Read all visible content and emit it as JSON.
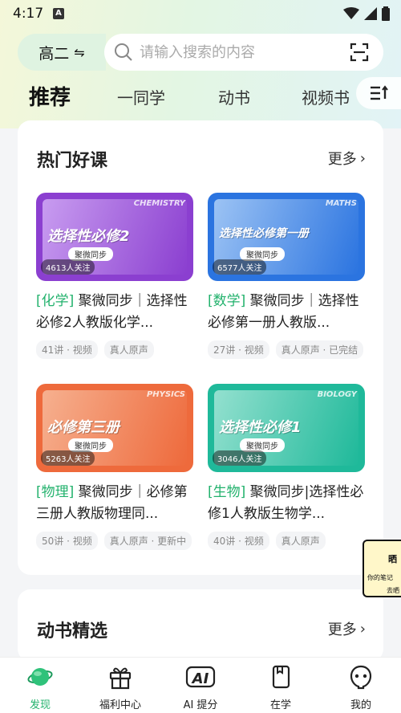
{
  "status": {
    "time": "4:17"
  },
  "header": {
    "grade": "高二",
    "grade_swap_icon": "swap-icon",
    "search_placeholder": "请输入搜索的内容"
  },
  "tabs": [
    {
      "label": "推荐",
      "active": true
    },
    {
      "label": "一同学"
    },
    {
      "label": "动书"
    },
    {
      "label": "视频书"
    }
  ],
  "hot_courses": {
    "title": "热门好课",
    "more": "更多",
    "items": [
      {
        "tag": "[化学]",
        "title": " 聚微同步｜选择性必修2人教版化学...",
        "followers": "4613人关注",
        "cover_title": "选择性必修2",
        "cover_sub": "聚微同步",
        "cover_en": "CHEMISTRY",
        "chips": [
          "41讲 · 视频",
          "真人原声"
        ],
        "color_a": "#8b3fd0",
        "color_b": "#c89cf0"
      },
      {
        "tag": "[数学]",
        "title": " 聚微同步｜选择性必修第一册人教版...",
        "followers": "6577人关注",
        "cover_title": "选择性必修第一册",
        "cover_sub": "聚微同步",
        "cover_en": "MATHS",
        "chips": [
          "27讲 · 视频",
          "真人原声 · 已完结"
        ],
        "color_a": "#2b74e0",
        "color_b": "#9cc3f4"
      },
      {
        "tag": "[物理]",
        "title": " 聚微同步｜必修第三册人教版物理同...",
        "followers": "5263人关注",
        "cover_title": "必修第三册",
        "cover_sub": "聚微同步",
        "cover_en": "PHYSICS",
        "chips": [
          "50讲 · 视频",
          "真人原声 · 更新中"
        ],
        "color_a": "#ee6a3c",
        "color_b": "#f6b08f"
      },
      {
        "tag": "[生物]",
        "title": " 聚微同步|选择性必修1人教版生物学...",
        "followers": "3046人关注",
        "cover_title": "选择性必修1",
        "cover_sub": "聚微同步",
        "cover_en": "BIOLOGY",
        "chips": [
          "40讲 · 视频",
          "真人原声"
        ],
        "color_a": "#1fb99a",
        "color_b": "#93e0cf"
      }
    ]
  },
  "dongshu": {
    "title": "动书精选",
    "more": "更多"
  },
  "side_float": {
    "t1": "晒",
    "t2": "你的笔记",
    "t3": "去晒"
  },
  "bottom_nav": [
    {
      "label": "发现",
      "icon": "discover-planet-icon",
      "active": true
    },
    {
      "label": "福利中心",
      "icon": "gift-icon"
    },
    {
      "label": "AI 提分",
      "icon": "ai-icon"
    },
    {
      "label": "在学",
      "icon": "book-icon"
    },
    {
      "label": "我的",
      "icon": "profile-face-icon"
    }
  ]
}
